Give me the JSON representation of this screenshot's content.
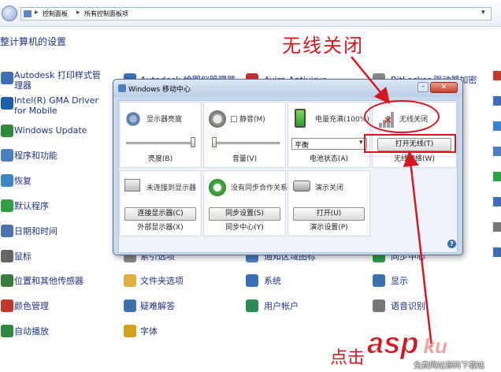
{
  "breadcrumb": {
    "parts": [
      "控制面板",
      "所有控制面板项"
    ]
  },
  "page_heading": "整计算机的设置",
  "col1": [
    {
      "label": "Autodesk 打印样式管理器",
      "icon": "printer-style-icon",
      "color": "#3b6fb6"
    },
    {
      "label": "Intel(R) GMA Driver for Mobile",
      "icon": "intel-gma-icon",
      "color": "#1b5faa"
    },
    {
      "label": "Windows Update",
      "icon": "windows-update-icon",
      "color": "#2e8b3a"
    },
    {
      "label": "程序和功能",
      "icon": "programs-features-icon",
      "color": "#4a7fc1"
    },
    {
      "label": "恢复",
      "icon": "recovery-icon",
      "color": "#3a86c8"
    },
    {
      "label": "默认程序",
      "icon": "default-programs-icon",
      "color": "#2f9e44"
    },
    {
      "label": "日期和时间",
      "icon": "date-time-icon",
      "color": "#4b72b0"
    },
    {
      "label": "鼠标",
      "icon": "mouse-icon",
      "color": "#666666"
    },
    {
      "label": "位置和其他传感器",
      "icon": "location-sensors-icon",
      "color": "#3a7d3a"
    },
    {
      "label": "颜色管理",
      "icon": "color-management-icon",
      "color": "#c0392b"
    },
    {
      "label": "自动播放",
      "icon": "autoplay-icon",
      "color": "#2d8a3e"
    }
  ],
  "col2": [
    {
      "label": "Autodesk 绘图仪管理器",
      "icon": "plotter-manager-icon",
      "color": "#3b6fb6"
    },
    {
      "label": "索引选项",
      "icon": "indexing-options-icon",
      "color": "#888888"
    },
    {
      "label": "文件夹选项",
      "icon": "folder-options-icon",
      "color": "#e0b040"
    },
    {
      "label": "疑难解答",
      "icon": "troubleshooting-icon",
      "color": "#3a6fb0"
    },
    {
      "label": "字体",
      "icon": "fonts-icon",
      "color": "#d4a017"
    }
  ],
  "col3": [
    {
      "label": "Avira Antivirus",
      "icon": "avira-icon",
      "color": "#d32f2f"
    },
    {
      "label": "通知区域图标",
      "icon": "notification-icons-icon",
      "color": "#4a7fc1"
    },
    {
      "label": "系统",
      "icon": "system-icon",
      "color": "#3b6fb6"
    },
    {
      "label": "用户帐户",
      "icon": "user-accounts-icon",
      "color": "#2e8b57"
    }
  ],
  "col4": [
    {
      "label": "BitLocker 驱动器加密",
      "icon": "bitlocker-icon",
      "color": "#888888"
    },
    {
      "label": "同步中心",
      "icon": "sync-center-icon",
      "color": "#2e9e44"
    },
    {
      "label": "显示",
      "icon": "display-icon",
      "color": "#3a6fb0"
    },
    {
      "label": "语音识别",
      "icon": "speech-recognition-icon",
      "color": "#777777"
    }
  ],
  "mobility": {
    "title": "Windows 移动中心",
    "tiles": [
      {
        "title": "显示器亮度",
        "caption": "亮度(B)"
      },
      {
        "title": "静音(M)",
        "caption": "音量(V)"
      },
      {
        "title": "电量充满(100%)",
        "caption": "电池状态(A)",
        "select": "平衡"
      },
      {
        "title": "无线关闭",
        "caption": "无线网络(W)",
        "button": "打开无线(T)"
      },
      {
        "title": "未连接到显示器",
        "caption": "外部显示器(X)",
        "button": "连接显示器(C)"
      },
      {
        "title": "没有同步合作关系",
        "caption": "同步中心(Y)",
        "button": "同步设置(S)"
      },
      {
        "title": "演示关闭",
        "caption": "演示设置(P)",
        "button": "打开(U)"
      }
    ]
  },
  "annotations": {
    "wireless_off": "无线关闭",
    "click": "点击"
  },
  "watermark": {
    "brand": "asp",
    "suffix": "ku",
    "site": "免费网站源码下载站"
  },
  "colors": {
    "annotation_red": "#d7171f",
    "link_blue": "#1e3287"
  }
}
